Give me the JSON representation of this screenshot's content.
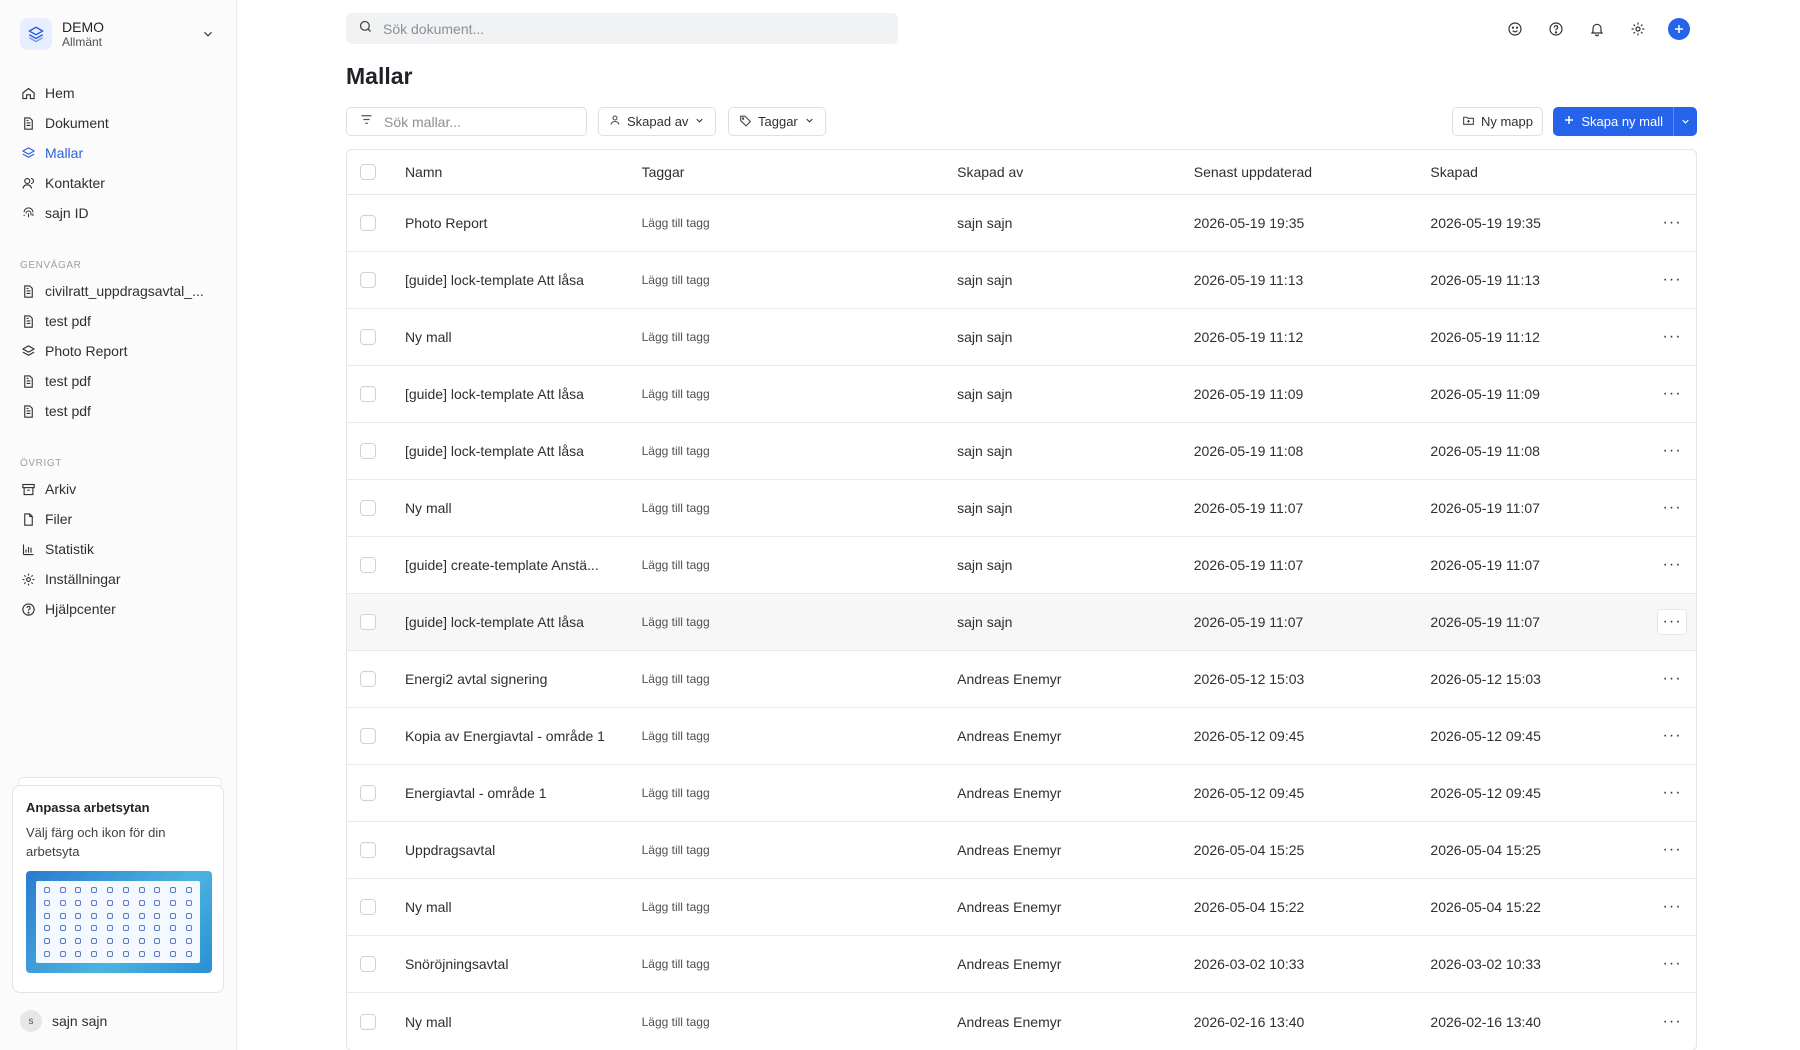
{
  "workspace": {
    "name": "DEMO",
    "subtitle": "Allmänt"
  },
  "nav": [
    {
      "label": "Hem",
      "icon": "home-icon"
    },
    {
      "label": "Dokument",
      "icon": "document-icon"
    },
    {
      "label": "Mallar",
      "icon": "layers-icon",
      "active": true
    },
    {
      "label": "Kontakter",
      "icon": "contacts-icon"
    },
    {
      "label": "sajn ID",
      "icon": "fingerprint-icon"
    }
  ],
  "shortcuts_title": "GENVÄGAR",
  "shortcuts": [
    {
      "label": "civilratt_uppdragsavtal_...",
      "icon": "document-icon"
    },
    {
      "label": "test pdf",
      "icon": "document-icon"
    },
    {
      "label": "Photo Report",
      "icon": "layers-icon"
    },
    {
      "label": "test pdf",
      "icon": "document-icon"
    },
    {
      "label": "test pdf",
      "icon": "document-icon"
    }
  ],
  "other_title": "ÖVRIGT",
  "other": [
    {
      "label": "Arkiv",
      "icon": "archive-icon"
    },
    {
      "label": "Filer",
      "icon": "file-icon"
    },
    {
      "label": "Statistik",
      "icon": "chart-icon"
    },
    {
      "label": "Inställningar",
      "icon": "gear-icon"
    },
    {
      "label": "Hjälpcenter",
      "icon": "help-icon"
    }
  ],
  "promo": {
    "title": "Anpassa arbetsytan",
    "text": "Välj färg och ikon för din arbetsyta"
  },
  "user": {
    "initial": "s",
    "name": "sajn sajn"
  },
  "search": {
    "placeholder": "Sök dokument..."
  },
  "page": {
    "title": "Mallar"
  },
  "toolbar": {
    "filter_placeholder": "Sök mallar...",
    "created_by": "Skapad av",
    "tags": "Taggar",
    "new_folder": "Ny mapp",
    "create": "Skapa ny mall"
  },
  "table": {
    "headers": {
      "name": "Namn",
      "tags": "Taggar",
      "created_by": "Skapad av",
      "updated": "Senast uppdaterad",
      "created": "Skapad"
    },
    "rows": [
      {
        "name": "Photo Report",
        "tag": "Lägg till tagg",
        "by": "sajn sajn",
        "updated": "2026-05-19 19:35",
        "created": "2026-05-19 19:35"
      },
      {
        "name": "[guide] lock-template Att låsa",
        "tag": "Lägg till tagg",
        "by": "sajn sajn",
        "updated": "2026-05-19 11:13",
        "created": "2026-05-19 11:13"
      },
      {
        "name": "Ny mall",
        "tag": "Lägg till tagg",
        "by": "sajn sajn",
        "updated": "2026-05-19 11:12",
        "created": "2026-05-19 11:12"
      },
      {
        "name": "[guide] lock-template Att låsa",
        "tag": "Lägg till tagg",
        "by": "sajn sajn",
        "updated": "2026-05-19 11:09",
        "created": "2026-05-19 11:09"
      },
      {
        "name": "[guide] lock-template Att låsa",
        "tag": "Lägg till tagg",
        "by": "sajn sajn",
        "updated": "2026-05-19 11:08",
        "created": "2026-05-19 11:08"
      },
      {
        "name": "Ny mall",
        "tag": "Lägg till tagg",
        "by": "sajn sajn",
        "updated": "2026-05-19 11:07",
        "created": "2026-05-19 11:07"
      },
      {
        "name": "[guide] create-template Anstä...",
        "tag": "Lägg till tagg",
        "by": "sajn sajn",
        "updated": "2026-05-19 11:07",
        "created": "2026-05-19 11:07"
      },
      {
        "name": "[guide] lock-template Att låsa",
        "tag": "Lägg till tagg",
        "by": "sajn sajn",
        "updated": "2026-05-19 11:07",
        "created": "2026-05-19 11:07"
      },
      {
        "name": "Energi2 avtal signering",
        "tag": "Lägg till tagg",
        "by": "Andreas Enemyr",
        "updated": "2026-05-12 15:03",
        "created": "2026-05-12 15:03"
      },
      {
        "name": "Kopia av Energiavtal - område 1",
        "tag": "Lägg till tagg",
        "by": "Andreas Enemyr",
        "updated": "2026-05-12 09:45",
        "created": "2026-05-12 09:45"
      },
      {
        "name": "Energiavtal - område 1",
        "tag": "Lägg till tagg",
        "by": "Andreas Enemyr",
        "updated": "2026-05-12 09:45",
        "created": "2026-05-12 09:45"
      },
      {
        "name": "Uppdragsavtal",
        "tag": "Lägg till tagg",
        "by": "Andreas Enemyr",
        "updated": "2026-05-04 15:25",
        "created": "2026-05-04 15:25"
      },
      {
        "name": "Ny mall",
        "tag": "Lägg till tagg",
        "by": "Andreas Enemyr",
        "updated": "2026-05-04 15:22",
        "created": "2026-05-04 15:22"
      },
      {
        "name": "Snöröjningsavtal",
        "tag": "Lägg till tagg",
        "by": "Andreas Enemyr",
        "updated": "2026-03-02 10:33",
        "created": "2026-03-02 10:33"
      },
      {
        "name": "Ny mall",
        "tag": "Lägg till tagg",
        "by": "Andreas Enemyr",
        "updated": "2026-02-16 13:40",
        "created": "2026-02-16 13:40"
      }
    ]
  },
  "colors": {
    "accent": "#2563eb",
    "active_nav": "#2f5fe0"
  }
}
